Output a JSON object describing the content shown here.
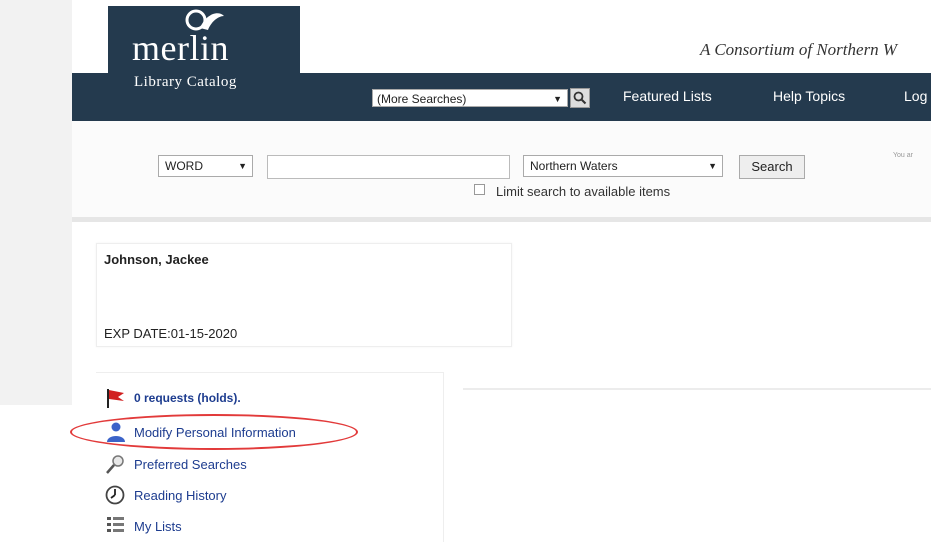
{
  "header": {
    "tagline": "A Consortium of Northern W",
    "logo_word": "merlin",
    "logo_sub": "Library Catalog"
  },
  "navbar": {
    "more_searches": "(More Searches)",
    "links": [
      "Featured Lists",
      "Help Topics",
      "Log"
    ]
  },
  "search": {
    "type_value": "WORD",
    "input_value": "",
    "region_value": "Northern Waters",
    "button_label": "Search",
    "limit_label": "Limit search to available items",
    "limit_checked": false,
    "right_note": "You ar"
  },
  "patron": {
    "name": "Johnson, Jackee",
    "expiration": "EXP DATE:01-15-2020"
  },
  "account_menu": [
    {
      "label": "0 requests (holds).",
      "icon": "red-flag-icon"
    },
    {
      "label": "Modify Personal Information",
      "icon": "person-icon",
      "highlighted": true
    },
    {
      "label": "Preferred Searches",
      "icon": "magnifier-icon"
    },
    {
      "label": "Reading History",
      "icon": "clock-icon"
    },
    {
      "label": "My Lists",
      "icon": "list-icon"
    }
  ],
  "colors": {
    "navbar": "#243a4e",
    "link": "#1d3c8f",
    "highlight": "#e23a3a"
  }
}
